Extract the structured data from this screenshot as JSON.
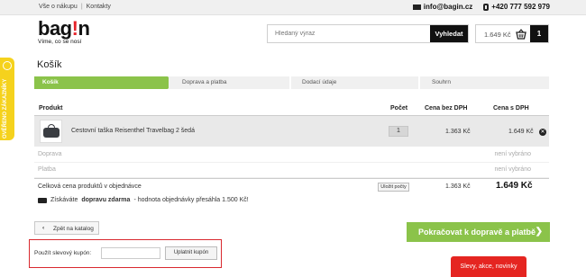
{
  "topbar": {
    "links": [
      "Vše o nákupu",
      "Kontakty"
    ],
    "separator": "|",
    "email": "info@bagin.cz",
    "phone": "+420 777 592 979"
  },
  "logo": {
    "word_start": "bag",
    "word_red": "!",
    "word_end": "n",
    "tagline": "Víme, co se nosí"
  },
  "search": {
    "placeholder": "Hledaný výraz",
    "button": "Vyhledat"
  },
  "cart": {
    "price": "1.649 Kč",
    "count": "1"
  },
  "side_badge": {
    "text": "OVĚŘENO ZÁKAZNÍKY"
  },
  "page_title": "Košík",
  "steps": [
    {
      "label": "Košík",
      "active": true
    },
    {
      "label": "Doprava a platba",
      "active": false
    },
    {
      "label": "Dodací údaje",
      "active": false
    },
    {
      "label": "Souhrn",
      "active": false
    }
  ],
  "table": {
    "headers": {
      "product": "Produkt",
      "count": "Počet",
      "price_net": "Cena bez DPH",
      "price_gross": "Cena s DPH"
    },
    "item": {
      "name": "Cestovní taška Reisenthel Travelbag 2 šedá",
      "qty": "1",
      "price_net": "1.363 Kč",
      "price_gross": "1.649 Kč"
    },
    "shipping": {
      "label": "Doprava",
      "value": "není vybráno"
    },
    "payment": {
      "label": "Platba",
      "value": "není vybráno"
    },
    "total": {
      "label": "Celková cena produktů v objednávce",
      "recalc": "Uložit počty",
      "price_net": "1.363 Kč",
      "price_gross": "1.649 Kč"
    }
  },
  "free_shipping": {
    "prefix": "Získáváte",
    "bold": "dopravu zdarma",
    "suffix": "- hodnota objednávky přesáhla 1.500 Kč!"
  },
  "back_button": "Zpět na katalog",
  "continue_button": "Pokračovat k dopravě a platbě",
  "coupon": {
    "label": "Použít slevový kupón:",
    "button": "Uplatnit kupón"
  },
  "promo_tab": "Slevy, akce, novinky",
  "colors": {
    "accent_green": "#8bc34a",
    "brand_red": "#e5232a",
    "badge_yellow": "#f5d21d"
  }
}
